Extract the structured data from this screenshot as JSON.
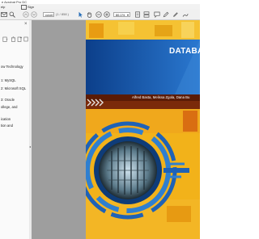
{
  "window": {
    "title": "e Acrobat Pro DC"
  },
  "menu": [
    "elp",
    "Sign"
  ],
  "toolbar": {
    "current_page": "cover",
    "page_count_label": "(1 / 858 )",
    "zoom": "86.1%"
  },
  "bookmarks": [
    "ow Technology",
    "1: MySQL",
    "2: Microsoft SQL",
    "3: Oracle",
    "ollege, and",
    "ication",
    "tion and"
  ],
  "cover": {
    "title": "DATABA",
    "authors": "Alfred Basta, Melissa Zgola, Dana Bu",
    "colors": {
      "title_band": "#1d5fb4",
      "background": "#f2b21a",
      "author_band": "#6a2208"
    }
  }
}
